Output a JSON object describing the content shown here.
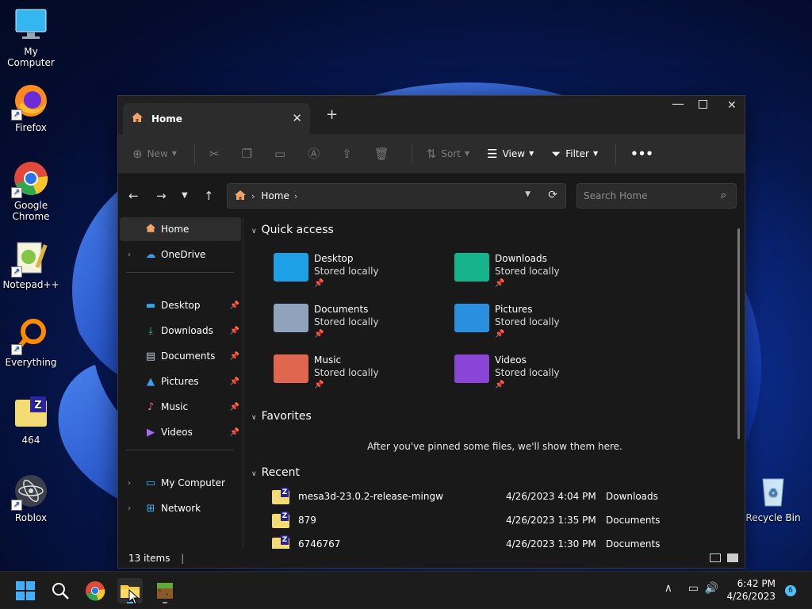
{
  "desktop": {
    "icons": [
      {
        "label": "My Computer",
        "icon": "monitor-icon"
      },
      {
        "label": "Firefox",
        "icon": "firefox-icon"
      },
      {
        "label": "Google Chrome",
        "icon": "chrome-icon"
      },
      {
        "label": "Notepad++",
        "icon": "notepad-plus-plus-icon"
      },
      {
        "label": "Everything",
        "icon": "everything-search-icon"
      },
      {
        "label": "464",
        "icon": "zip-folder-icon"
      },
      {
        "label": "Roblox",
        "icon": "roblox-icon"
      }
    ],
    "recycle_bin": "Recycle Bin"
  },
  "window": {
    "tab_title": "Home",
    "commands": {
      "new": "New",
      "sort": "Sort",
      "view": "View",
      "filter": "Filter"
    },
    "address": {
      "crumb": "Home"
    },
    "search_placeholder": "Search Home",
    "nav": {
      "home": "Home",
      "onedrive": "OneDrive",
      "pinned": [
        {
          "label": "Desktop",
          "icon": "desktop-icon"
        },
        {
          "label": "Downloads",
          "icon": "download-icon"
        },
        {
          "label": "Documents",
          "icon": "document-icon"
        },
        {
          "label": "Pictures",
          "icon": "picture-icon"
        },
        {
          "label": "Music",
          "icon": "music-icon"
        },
        {
          "label": "Videos",
          "icon": "video-icon"
        }
      ],
      "my_computer": "My Computer",
      "network": "Network"
    },
    "quick_access": {
      "title": "Quick access",
      "items": [
        {
          "name": "Desktop",
          "status": "Stored locally",
          "color": "#1ea0e6"
        },
        {
          "name": "Downloads",
          "status": "Stored locally",
          "color": "#17b38c"
        },
        {
          "name": "Documents",
          "status": "Stored locally",
          "color": "#8fa3bd"
        },
        {
          "name": "Pictures",
          "status": "Stored locally",
          "color": "#2b8fe0"
        },
        {
          "name": "Music",
          "status": "Stored locally",
          "color": "#e0664f"
        },
        {
          "name": "Videos",
          "status": "Stored locally",
          "color": "#8a45d6"
        }
      ]
    },
    "favorites": {
      "title": "Favorites",
      "empty_text": "After you've pinned some files, we'll show them here."
    },
    "recent": {
      "title": "Recent",
      "items": [
        {
          "name": "mesa3d-23.0.2-release-mingw",
          "date": "4/26/2023 4:04 PM",
          "location": "Downloads"
        },
        {
          "name": "879",
          "date": "4/26/2023 1:35 PM",
          "location": "Documents"
        },
        {
          "name": "6746767",
          "date": "4/26/2023 1:30 PM",
          "location": "Documents"
        }
      ]
    },
    "status": {
      "count": "13 items"
    }
  },
  "taskbar": {
    "time": "6:42 PM",
    "date": "4/26/2023",
    "notifications": "6"
  }
}
